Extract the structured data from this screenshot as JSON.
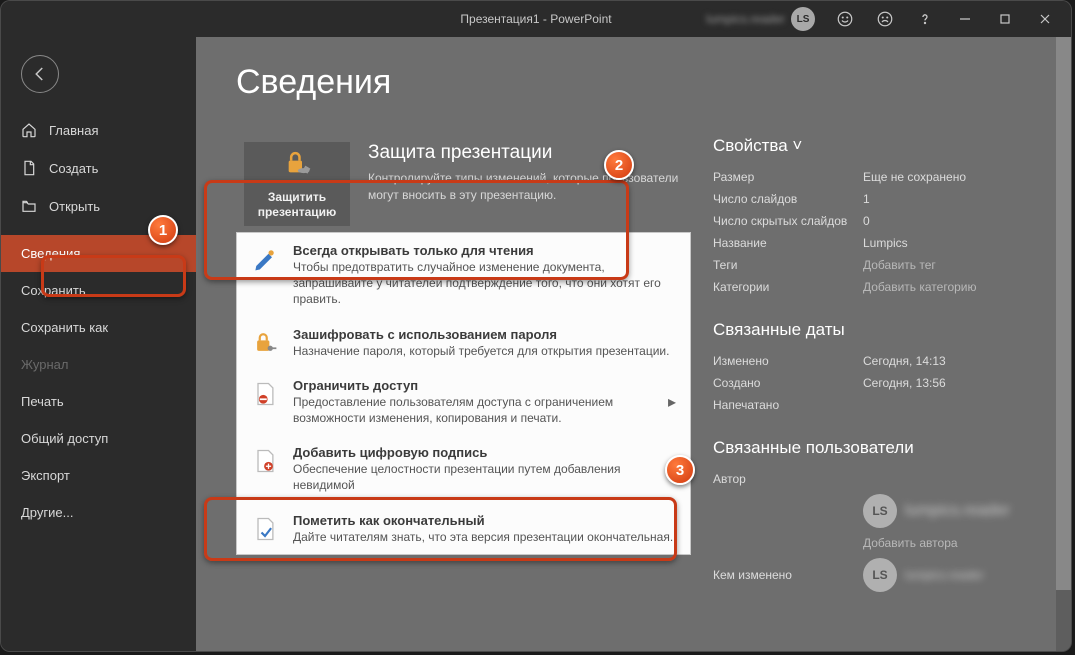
{
  "title": "Презентация1 - PowerPoint",
  "user_initials": "LS",
  "user_name": "lumpics.reader",
  "sidebar": {
    "home": "Главная",
    "new": "Создать",
    "open": "Открыть",
    "info": "Сведения",
    "save": "Сохранить",
    "saveas": "Сохранить как",
    "history": "Журнал",
    "print": "Печать",
    "share": "Общий доступ",
    "export": "Экспорт",
    "more": "Другие..."
  },
  "page_heading": "Сведения",
  "protect": {
    "btn": "Защитить презентацию",
    "title": "Защита презентации",
    "desc": "Контролируйте типы изменений, которые пользователи могут вносить в эту презентацию."
  },
  "menu": {
    "readonly": {
      "title": "Всегда открывать только для чтения",
      "desc": "Чтобы предотвратить случайное изменение документа, запрашивайте у читателей подтверждение того, что они хотят его править."
    },
    "encrypt": {
      "title": "Зашифровать с использованием пароля",
      "desc": "Назначение пароля, который требуется для открытия презентации."
    },
    "restrict": {
      "title": "Ограничить доступ",
      "desc": "Предоставление пользователям доступа с ограничением возможности изменения, копирования и печати."
    },
    "sign": {
      "title": "Добавить цифровую подпись",
      "desc": "Обеспечение целостности презентации путем добавления невидимой"
    },
    "final": {
      "title": "Пометить как окончательный",
      "desc": "Дайте читателям знать, что эта версия презентации окончательная."
    }
  },
  "props": {
    "heading": "Свойства ˅",
    "rows": {
      "size": {
        "label": "Размер",
        "value": "Еще не сохранено"
      },
      "slides": {
        "label": "Число слайдов",
        "value": "1"
      },
      "hidden": {
        "label": "Число скрытых слайдов",
        "value": "0"
      },
      "title": {
        "label": "Название",
        "value": "Lumpics"
      },
      "tags": {
        "label": "Теги",
        "value": "Добавить тег"
      },
      "categories": {
        "label": "Категории",
        "value": "Добавить категорию"
      }
    },
    "dates_heading": "Связанные даты",
    "dates": {
      "modified": {
        "label": "Изменено",
        "value": "Сегодня, 14:13"
      },
      "created": {
        "label": "Создано",
        "value": "Сегодня, 13:56"
      },
      "printed": {
        "label": "Напечатано",
        "value": ""
      }
    },
    "people_heading": "Связанные пользователи",
    "people": {
      "author_label": "Автор",
      "add_author": "Добавить автора",
      "modified_by_label": "Кем изменено"
    }
  },
  "annotations": {
    "1": "1",
    "2": "2",
    "3": "3"
  }
}
